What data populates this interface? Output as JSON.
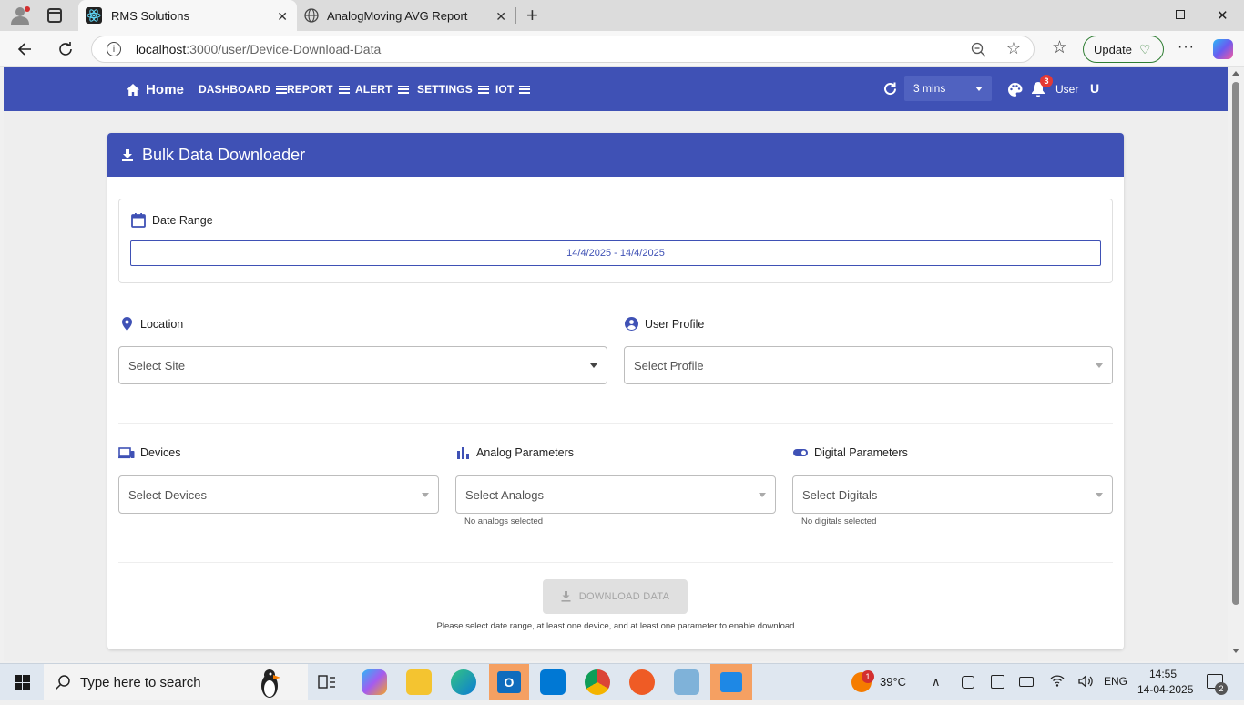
{
  "browser": {
    "tabs": [
      {
        "title": "RMS Solutions",
        "active": true
      },
      {
        "title": "AnalogMoving AVG Report",
        "active": false
      }
    ],
    "url_host": "localhost",
    "url_path": ":3000/user/Device-Download-Data",
    "update_label": "Update"
  },
  "appbar": {
    "home_label": "Home",
    "menu": [
      "DASHBOARD",
      "REPORT",
      "ALERT",
      "SETTINGS",
      "IOT"
    ],
    "refresh_interval": "3 mins",
    "notification_count": "3",
    "user_label": "User",
    "user_initial": "U"
  },
  "card": {
    "title": "Bulk Data Downloader",
    "date_range": {
      "label": "Date Range",
      "value": "14/4/2025 - 14/4/2025"
    },
    "location": {
      "label": "Location",
      "placeholder": "Select Site"
    },
    "user_profile": {
      "label": "User Profile",
      "placeholder": "Select Profile"
    },
    "devices": {
      "label": "Devices",
      "placeholder": "Select Devices"
    },
    "analog": {
      "label": "Analog Parameters",
      "placeholder": "Select Analogs",
      "helper": "No analogs selected"
    },
    "digital": {
      "label": "Digital Parameters",
      "placeholder": "Select Digitals",
      "helper": "No digitals selected"
    },
    "download_label": "DOWNLOAD DATA",
    "download_hint": "Please select date range, at least one device, and at least one parameter to enable download"
  },
  "taskbar": {
    "search_placeholder": "Type here to search",
    "weather_badge": "1",
    "temperature": "39°C",
    "language": "ENG",
    "time": "14:55",
    "date": "14-04-2025",
    "notification_count": "2"
  },
  "colors": {
    "primary": "#3f51b5",
    "disabled_bg": "#e0e0e0",
    "badge": "#e53935"
  }
}
